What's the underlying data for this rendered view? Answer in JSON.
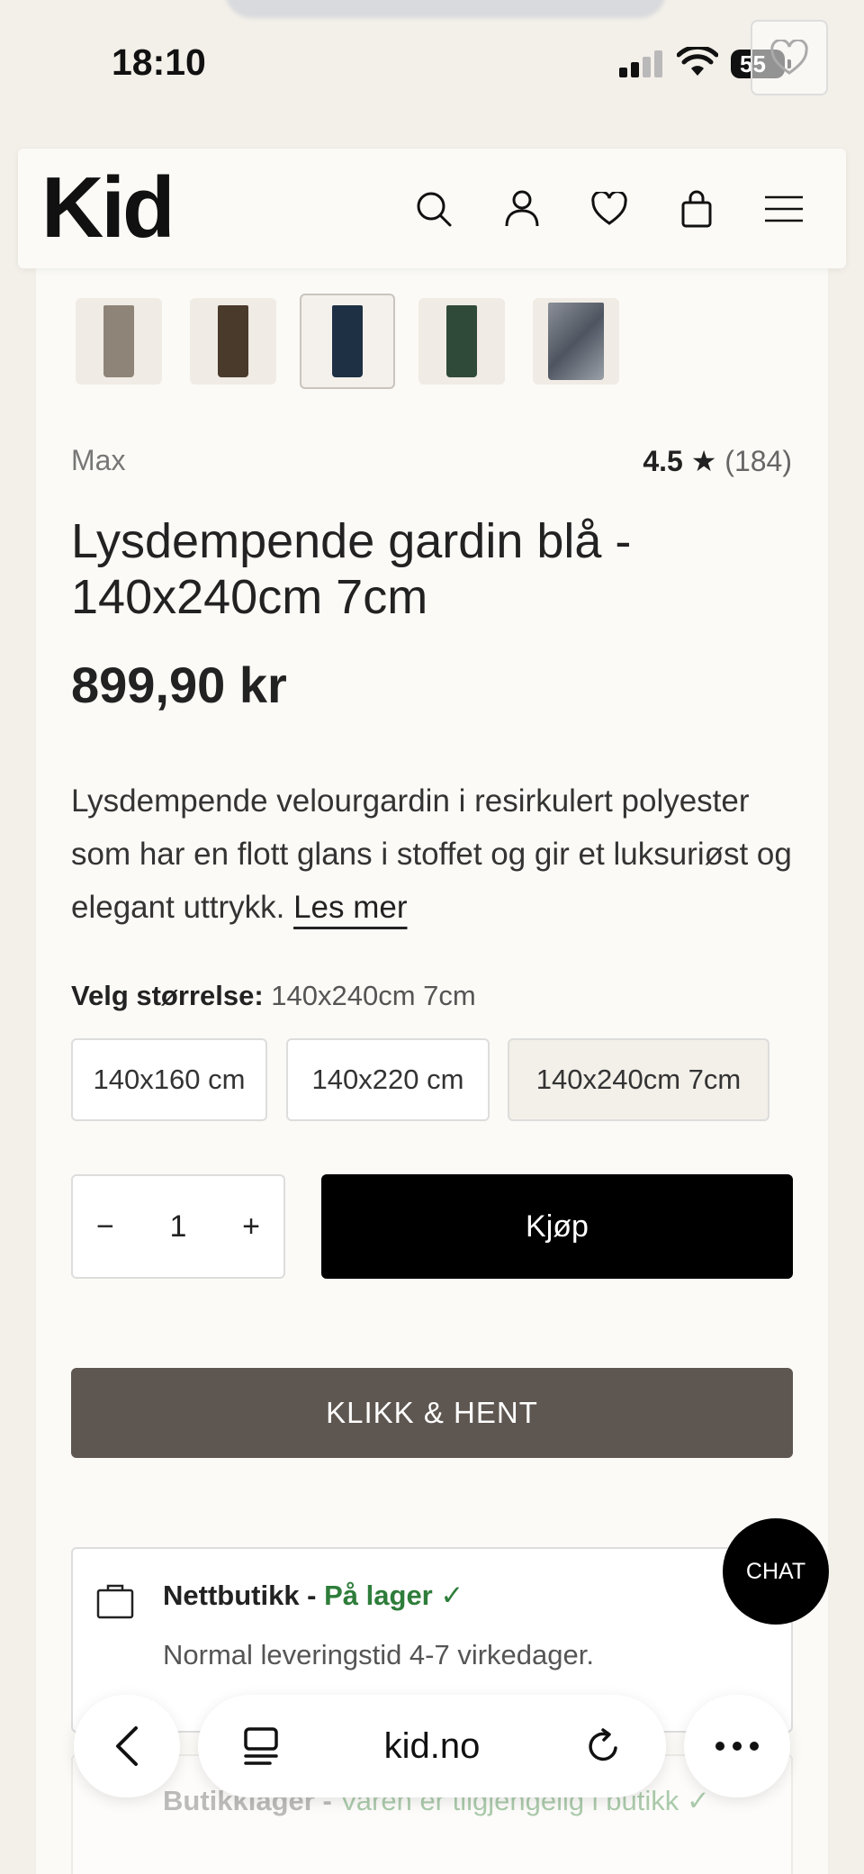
{
  "status_bar": {
    "time": "18:10",
    "battery": "55"
  },
  "header": {
    "logo": "Kid"
  },
  "product": {
    "brand": "Max",
    "rating_value": "4.5 ★",
    "rating_count": "(184)",
    "title": "Lysdempende gardin blå - 140x240cm 7cm",
    "price": "899,90 kr",
    "description": "Lysdempende velourgardin i resirkulert polyester som har en flott glans i stoffet og gir et luksuriøst og elegant uttrykk.",
    "read_more": "Les mer",
    "thumbnails": [
      "#8f8478",
      "#4a3a2c",
      "#1e3044",
      "#2f4a38",
      "#6f747c"
    ]
  },
  "size": {
    "label": "Velg størrelse:",
    "selected": "140x240cm 7cm",
    "options": [
      "140x160 cm",
      "140x220 cm",
      "140x240cm 7cm"
    ]
  },
  "purchase": {
    "quantity": "1",
    "minus": "−",
    "plus": "+",
    "buy_label": "Kjøp",
    "click_collect_label": "KLIKK & HENT"
  },
  "stock": {
    "online_title": "Nettbutikk -",
    "online_status": "På lager ✓",
    "online_sub": "Normal leveringstid 4-7 virkedager.",
    "store_title": "Butikklager -",
    "store_status": "Varen er tilgjengelig i butikk ✓"
  },
  "chat": {
    "label": "CHAT"
  },
  "browser": {
    "url": "kid.no"
  },
  "colors": {
    "buy": "#000000",
    "click_collect": "#5e5650",
    "in_stock": "#2e7d3a"
  }
}
